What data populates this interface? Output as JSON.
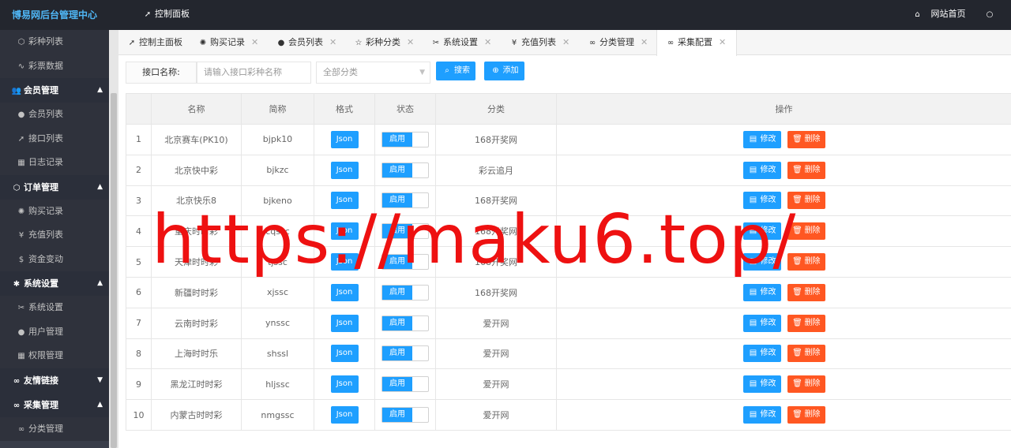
{
  "app": {
    "title": "博易网后台管理中心"
  },
  "topnav": {
    "dashboard": "控制面板",
    "site_home": "网站首页",
    "user_icon": "user-icon"
  },
  "sidebar": {
    "items_top": [
      {
        "label": "彩种列表",
        "icon": "cube-icon"
      },
      {
        "label": "彩票数据",
        "icon": "pulse-icon"
      }
    ],
    "groups": [
      {
        "label": "会员管理",
        "icon": "users-icon",
        "expanded": true,
        "items": [
          {
            "label": "会员列表",
            "icon": "user-icon"
          },
          {
            "label": "接口列表",
            "icon": "send-icon"
          },
          {
            "label": "日志记录",
            "icon": "calendar-icon"
          }
        ]
      },
      {
        "label": "订单管理",
        "icon": "cube-icon",
        "expanded": true,
        "items": [
          {
            "label": "购买记录",
            "icon": "fire-icon"
          },
          {
            "label": "充值列表",
            "icon": "yen-icon"
          },
          {
            "label": "资金变动",
            "icon": "dollar-icon"
          }
        ]
      },
      {
        "label": "系统设置",
        "icon": "gear-icon",
        "expanded": true,
        "items": [
          {
            "label": "系统设置",
            "icon": "tools-icon"
          },
          {
            "label": "用户管理",
            "icon": "user-icon"
          },
          {
            "label": "权限管理",
            "icon": "calendar-icon"
          }
        ]
      },
      {
        "label": "友情链接",
        "icon": "link-icon",
        "expanded": false,
        "items": []
      },
      {
        "label": "采集管理",
        "icon": "link-icon",
        "expanded": true,
        "items": [
          {
            "label": "分类管理",
            "icon": "link-icon"
          }
        ]
      }
    ]
  },
  "tabs": [
    {
      "label": "控制主面板"
    },
    {
      "label": "购买记录"
    },
    {
      "label": "会员列表"
    },
    {
      "label": "彩种分类"
    },
    {
      "label": "系统设置"
    },
    {
      "label": "充值列表"
    },
    {
      "label": "分类管理"
    },
    {
      "label": "采集配置"
    }
  ],
  "toolbar": {
    "label": "接口名称:",
    "search_placeholder": "请输入接口彩种名称",
    "category_select": "全部分类",
    "search_button": "搜索",
    "add_button": "添加"
  },
  "table": {
    "headers": [
      "",
      "名称",
      "简称",
      "格式",
      "状态",
      "分类",
      "操作"
    ],
    "format_label": "Json",
    "status_label": "启用",
    "edit_label": "修改",
    "delete_label": "删除",
    "rows": [
      {
        "no": "1",
        "name": "北京赛车(PK10)",
        "code": "bjpk10",
        "category": "168开奖网"
      },
      {
        "no": "2",
        "name": "北京快中彩",
        "code": "bjkzc",
        "category": "彩云追月"
      },
      {
        "no": "3",
        "name": "北京快乐8",
        "code": "bjkeno",
        "category": "168开奖网"
      },
      {
        "no": "4",
        "name": "重庆时时彩",
        "code": "cqssc",
        "category": "168开奖网"
      },
      {
        "no": "5",
        "name": "天津时时彩",
        "code": "tjssc",
        "category": "168开奖网"
      },
      {
        "no": "6",
        "name": "新疆时时彩",
        "code": "xjssc",
        "category": "168开奖网"
      },
      {
        "no": "7",
        "name": "云南时时彩",
        "code": "ynssc",
        "category": "爱开网"
      },
      {
        "no": "8",
        "name": "上海时时乐",
        "code": "shssl",
        "category": "爱开网"
      },
      {
        "no": "9",
        "name": "黑龙江时时彩",
        "code": "hljssc",
        "category": "爱开网"
      },
      {
        "no": "10",
        "name": "内蒙古时时彩",
        "code": "nmgssc",
        "category": "爱开网"
      }
    ]
  },
  "watermark": "https://maku6.top/"
}
